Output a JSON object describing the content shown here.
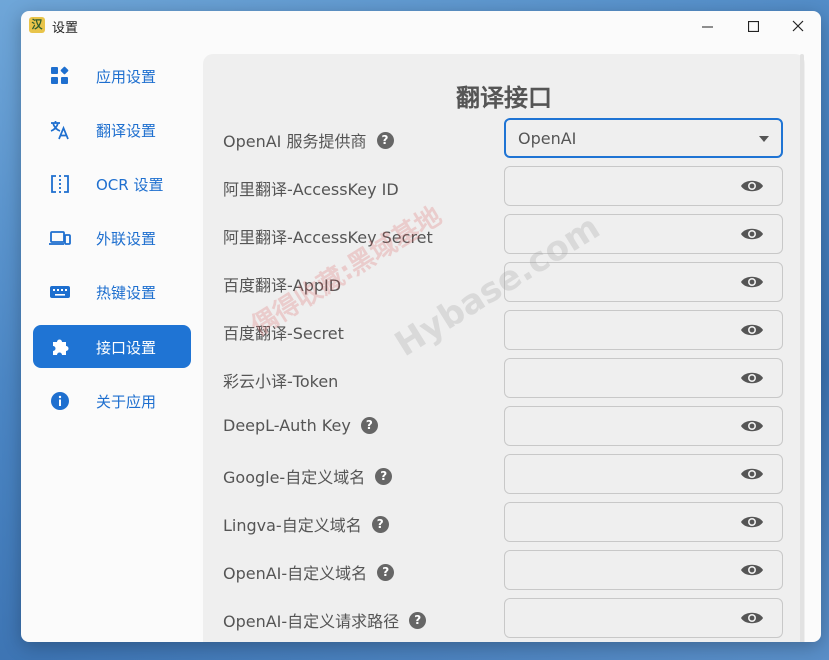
{
  "window": {
    "title": "设置",
    "app_icon_glyph": "汉"
  },
  "sidebar": {
    "items": [
      {
        "label": "应用设置",
        "icon": "apps-icon",
        "active": false
      },
      {
        "label": "翻译设置",
        "icon": "translate-icon",
        "active": false
      },
      {
        "label": "OCR 设置",
        "icon": "ocr-icon",
        "active": false
      },
      {
        "label": "外联设置",
        "icon": "devices-icon",
        "active": false
      },
      {
        "label": "热键设置",
        "icon": "keyboard-icon",
        "active": false
      },
      {
        "label": "接口设置",
        "icon": "puzzle-icon",
        "active": true
      },
      {
        "label": "关于应用",
        "icon": "info-icon",
        "active": false
      }
    ]
  },
  "panel": {
    "title": "翻译接口",
    "provider": {
      "label": "OpenAI 服务提供商",
      "value": "OpenAI",
      "has_help": true
    },
    "fields": [
      {
        "label": "阿里翻译-AccessKey ID",
        "value": "",
        "has_help": false
      },
      {
        "label": "阿里翻译-AccessKey Secret",
        "value": "",
        "has_help": false
      },
      {
        "label": "百度翻译-AppID",
        "value": "",
        "has_help": false
      },
      {
        "label": "百度翻译-Secret",
        "value": "",
        "has_help": false
      },
      {
        "label": "彩云小译-Token",
        "value": "",
        "has_help": false
      },
      {
        "label": "DeepL-Auth Key",
        "value": "",
        "has_help": true
      },
      {
        "label": "Google-自定义域名",
        "value": "",
        "has_help": true
      },
      {
        "label": "Lingva-自定义域名",
        "value": "",
        "has_help": true
      },
      {
        "label": "OpenAI-自定义域名",
        "value": "",
        "has_help": true
      },
      {
        "label": "OpenAI-自定义请求路径",
        "value": "",
        "has_help": true
      }
    ]
  },
  "watermark": {
    "text_cn": "偶得收藏:黑域基地",
    "text_en": "Hybase.com"
  },
  "colors": {
    "accent": "#1f74d4",
    "panel_bg": "#efefef",
    "label": "#555555"
  }
}
